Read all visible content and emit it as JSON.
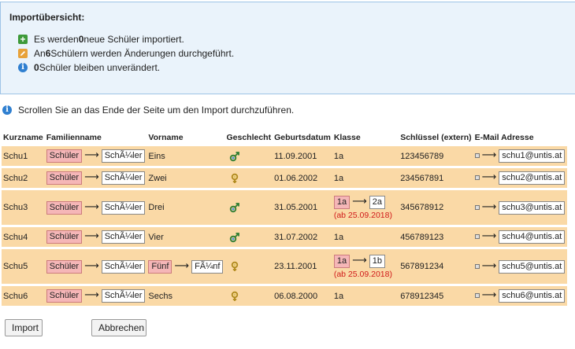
{
  "summary": {
    "title": "Importübersicht:",
    "new_pre": "Es werden ",
    "new_count": "0",
    "new_post": " neue Schüler importiert.",
    "changed_pre": "An ",
    "changed_count": "6",
    "changed_post": " Schülern werden Änderungen durchgeführt.",
    "unchanged_count": "0",
    "unchanged_post": " Schüler bleiben unverändert."
  },
  "scroll_hint": "Scrollen Sie an das Ende der Seite um den Import durchzuführen.",
  "table": {
    "headers": [
      "Kurzname",
      "Familienname",
      "Vorname",
      "Geschlecht",
      "Geburtsdatum",
      "Klasse",
      "Schlüssel (extern)",
      "E-Mail Adresse"
    ],
    "rows": [
      {
        "kurzname": "Schu1",
        "fam_old": "Schüler",
        "fam_new": "SchÃ¼ler",
        "vorname": "Eins",
        "vorname_changed": false,
        "gender": "male",
        "birth": "11.09.2001",
        "klasse": "1a",
        "klasse_changed": false,
        "key": "123456789",
        "email": "schu1@untis.at"
      },
      {
        "kurzname": "Schu2",
        "fam_old": "Schüler",
        "fam_new": "SchÃ¼ler",
        "vorname": "Zwei",
        "vorname_changed": false,
        "gender": "female",
        "birth": "01.06.2002",
        "klasse": "1a",
        "klasse_changed": false,
        "key": "234567891",
        "email": "schu2@untis.at"
      },
      {
        "kurzname": "Schu3",
        "fam_old": "Schüler",
        "fam_new": "SchÃ¼ler",
        "vorname": "Drei",
        "vorname_changed": false,
        "gender": "male",
        "birth": "31.05.2001",
        "klasse_old": "1a",
        "klasse_new": "2a",
        "klasse_changed": true,
        "klasse_note": "(ab 25.09.2018)",
        "key": "345678912",
        "email": "schu3@untis.at"
      },
      {
        "kurzname": "Schu4",
        "fam_old": "Schüler",
        "fam_new": "SchÃ¼ler",
        "vorname": "Vier",
        "vorname_changed": false,
        "gender": "male",
        "birth": "31.07.2002",
        "klasse": "1a",
        "klasse_changed": false,
        "key": "456789123",
        "email": "schu4@untis.at"
      },
      {
        "kurzname": "Schu5",
        "fam_old": "Schüler",
        "fam_new": "SchÃ¼ler",
        "vorname_old": "Fünf",
        "vorname_new": "FÃ¼nf",
        "vorname_changed": true,
        "gender": "female",
        "birth": "23.11.2001",
        "klasse_old": "1a",
        "klasse_new": "1b",
        "klasse_changed": true,
        "klasse_note": "(ab 25.09.2018)",
        "key": "567891234",
        "email": "schu5@untis.at"
      },
      {
        "kurzname": "Schu6",
        "fam_old": "Schüler",
        "fam_new": "SchÃ¼ler",
        "vorname": "Sechs",
        "vorname_changed": false,
        "gender": "female",
        "birth": "06.08.2000",
        "klasse": "1a",
        "klasse_changed": false,
        "key": "678912345",
        "email": "schu6@untis.at"
      }
    ]
  },
  "arrow": "⟶",
  "buttons": {
    "import": "Import",
    "cancel": "Abbrechen"
  },
  "colors": {
    "row_bg": "#fad9a6",
    "old_value_bg": "#f5b6b7",
    "summary_bg": "#eaf3fb",
    "note_red": "#d01a1a"
  }
}
